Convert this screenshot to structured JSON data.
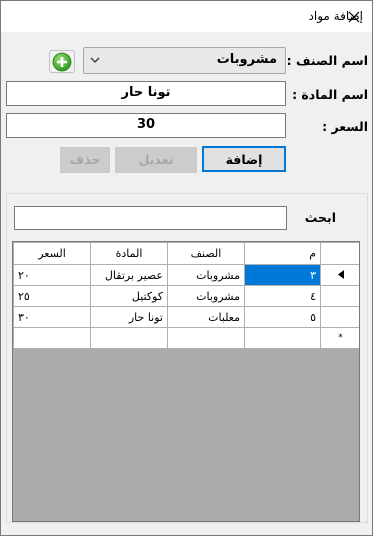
{
  "window": {
    "title": "إضافة مواد",
    "close_icon": "close-icon"
  },
  "form": {
    "category_label": "اسم الصنف :",
    "category_value": "مشروبات",
    "add_category_icon": "plus-circle-icon",
    "item_label": "اسم المادة :",
    "item_value": "تونا حار",
    "price_label": "السعر :",
    "price_value": "30"
  },
  "buttons": {
    "add": "إضافة",
    "edit": "تعديل",
    "delete": "حذف"
  },
  "search": {
    "label": "ابحث",
    "value": ""
  },
  "grid": {
    "columns": [
      "م",
      "الصنف",
      "المادة",
      "السعر"
    ],
    "rows": [
      {
        "id": "٣",
        "category": "مشروبات",
        "item": "عصير برتقال",
        "price": "٢٠",
        "selected": true
      },
      {
        "id": "٤",
        "category": "مشروبات",
        "item": "كوكتيل",
        "price": "٢٥"
      },
      {
        "id": "٥",
        "category": "معلبات",
        "item": "تونا حار",
        "price": "٣٠"
      }
    ],
    "new_row_marker": "*",
    "colors": {
      "selection": "#0078d7",
      "empty_area": "#ababab"
    }
  }
}
